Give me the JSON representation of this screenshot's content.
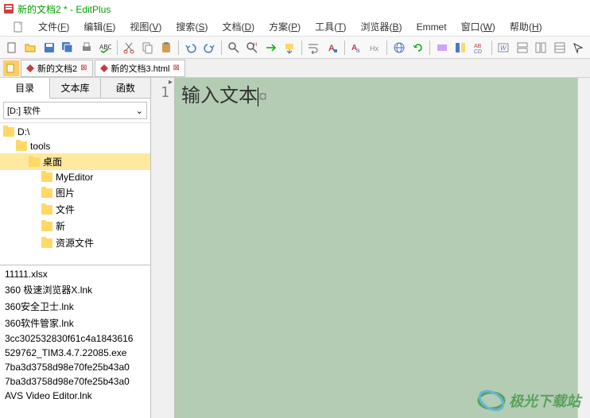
{
  "title": "新的文档2 * - EditPlus",
  "menu": [
    {
      "label": "文件",
      "key": "F"
    },
    {
      "label": "编辑",
      "key": "E"
    },
    {
      "label": "视图",
      "key": "V"
    },
    {
      "label": "搜索",
      "key": "S"
    },
    {
      "label": "文档",
      "key": "D"
    },
    {
      "label": "方案",
      "key": "P"
    },
    {
      "label": "工具",
      "key": "T"
    },
    {
      "label": "浏览器",
      "key": "B"
    },
    {
      "label": "Emmet",
      "key": ""
    },
    {
      "label": "窗口",
      "key": "W"
    },
    {
      "label": "帮助",
      "key": "H"
    }
  ],
  "tabs": [
    {
      "label": "新的文档2",
      "active": false
    },
    {
      "label": "新的文档3.html",
      "active": true
    }
  ],
  "sidebar": {
    "tabs": [
      "目录",
      "文本库",
      "函数"
    ],
    "active_tab": 0,
    "drive": "[D:] 软件",
    "tree": [
      {
        "label": "D:\\",
        "indent": 0,
        "selected": false
      },
      {
        "label": "tools",
        "indent": 1,
        "selected": false
      },
      {
        "label": "桌面",
        "indent": 2,
        "selected": true
      },
      {
        "label": "MyEditor",
        "indent": 3,
        "selected": false
      },
      {
        "label": "图片",
        "indent": 3,
        "selected": false
      },
      {
        "label": "文件",
        "indent": 3,
        "selected": false
      },
      {
        "label": "新",
        "indent": 3,
        "selected": false
      },
      {
        "label": "资源文件",
        "indent": 3,
        "selected": false
      }
    ],
    "files": [
      "11111.xlsx",
      "360 极速浏览器X.lnk",
      "360安全卫士.lnk",
      "360软件管家.lnk",
      "3cc302532830f61c4a1843616",
      "529762_TIM3.4.7.22085.exe",
      "7ba3d3758d98e70fe25b43a0",
      "7ba3d3758d98e70fe25b43a0",
      "AVS Video Editor.lnk"
    ]
  },
  "editor": {
    "line_number": "1",
    "content": "输入文本",
    "eol_symbol": "¤"
  },
  "watermark": "极光下载站"
}
